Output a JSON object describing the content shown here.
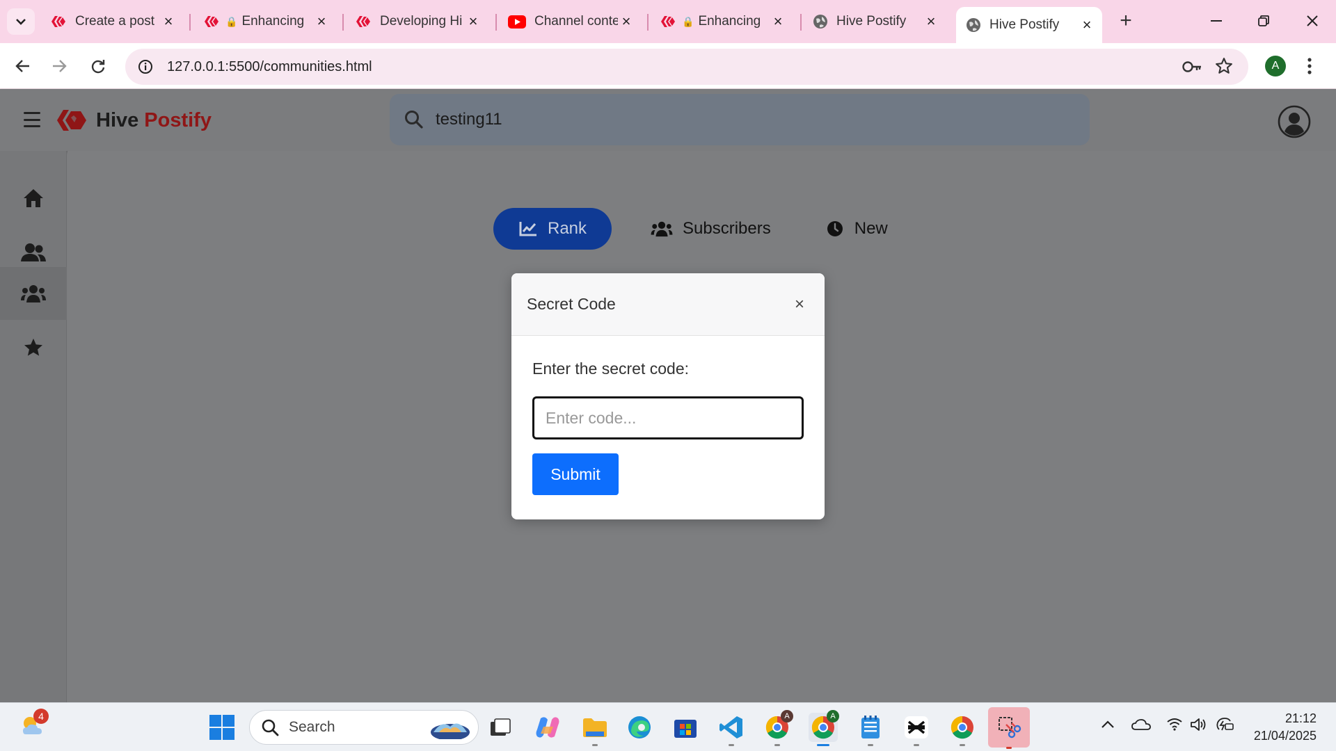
{
  "browser": {
    "tabs": [
      {
        "title": "Create a post",
        "icon": "hive-icon",
        "locked": false
      },
      {
        "title": "Enhancing",
        "icon": "hive-icon",
        "locked": true
      },
      {
        "title": "Developing Hi",
        "icon": "hive-icon",
        "locked": false
      },
      {
        "title": "Channel conte",
        "icon": "youtube-icon",
        "locked": false
      },
      {
        "title": "Enhancing",
        "icon": "hive-icon",
        "locked": true
      },
      {
        "title": "Hive Postify",
        "icon": "globe-icon",
        "locked": false
      },
      {
        "title": "Hive Postify",
        "icon": "globe-icon",
        "locked": false,
        "active": true
      }
    ],
    "url": "127.0.0.1:5500/communities.html",
    "profile_initial": "A"
  },
  "app": {
    "brand_part1": "Hive",
    "brand_part2": "Postify",
    "search_value": "testing11",
    "sort_tabs": [
      {
        "label": "Rank",
        "icon": "chart-line-icon",
        "active": true
      },
      {
        "label": "Subscribers",
        "icon": "users-icon",
        "active": false
      },
      {
        "label": "New",
        "icon": "clock-icon",
        "active": false
      }
    ],
    "sidebar": [
      "home-icon",
      "user-friends-icon",
      "users-icon",
      "star-icon"
    ]
  },
  "modal": {
    "title": "Secret Code",
    "close": "×",
    "label": "Enter the secret code:",
    "placeholder": "Enter code...",
    "submit": "Submit"
  },
  "taskbar": {
    "search_label": "Search",
    "weather_badge": "4",
    "time": "21:12",
    "date": "21/04/2025"
  },
  "colors": {
    "hive_red": "#e31337",
    "active_pill": "#0f3a94",
    "submit_blue": "#0d6efd",
    "brand_red": "#8f1616"
  }
}
